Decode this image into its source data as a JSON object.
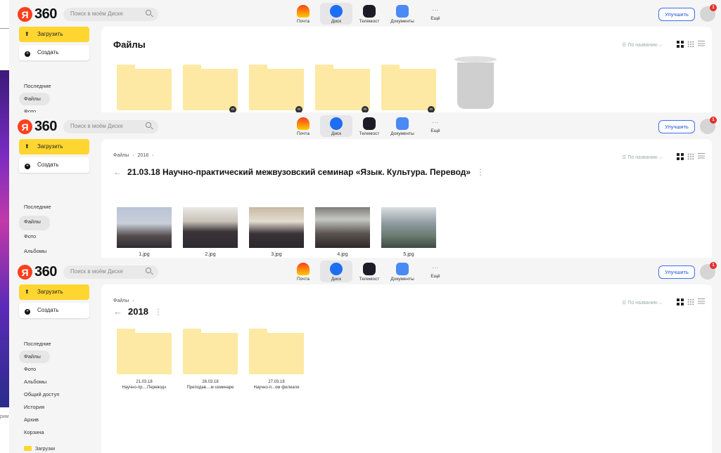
{
  "header": {
    "logo_ya": "Я",
    "logo_360": "360",
    "search_placeholder": "Поиск в моём Диске",
    "services": [
      {
        "label": "Почта",
        "icon": "mail-icon"
      },
      {
        "label": "Диск",
        "icon": "disk-icon"
      },
      {
        "label": "Телемост",
        "icon": "telemost-icon"
      },
      {
        "label": "Документы",
        "icon": "documents-icon"
      },
      {
        "label": "Ещё",
        "icon": "more-icon"
      }
    ],
    "upgrade_label": "Улучшить",
    "notification_count": "1"
  },
  "sidebar": {
    "upload_label": "Загрузить",
    "create_label": "Создать",
    "nav": [
      "Последние",
      "Файлы",
      "Фото",
      "Альбомы",
      "Общий доступ",
      "История",
      "Архив",
      "Корзина"
    ],
    "downloads_folder": "Загрузки"
  },
  "toolbar": {
    "sort_label": "По названию"
  },
  "panel1": {
    "title": "Файлы"
  },
  "panel2": {
    "breadcrumb": [
      "Файлы",
      "2018"
    ],
    "title": "21.03.18 Научно-практический межвузовский семинар «Язык. Культура. Перевод»",
    "photos": [
      "1.jpg",
      "2.jpg",
      "3.jpg",
      "4.jpg",
      "5.jpg"
    ]
  },
  "panel3": {
    "breadcrumb": [
      "Файлы"
    ],
    "title": "2018",
    "folders": [
      {
        "line1": "21.03.18",
        "line2": "Научно-пр....Перевод»"
      },
      {
        "line1": "26.03.18",
        "line2": "Преподав....м семинаре"
      },
      {
        "line1": "27.03.18",
        "line2": "Научно-п...ом филиале"
      }
    ]
  },
  "background_text": "рим"
}
